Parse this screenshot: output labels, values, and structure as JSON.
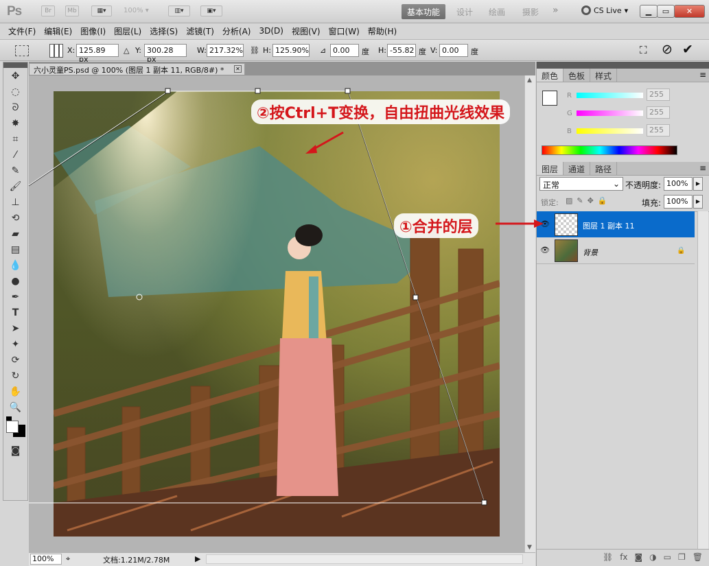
{
  "appbar": {
    "logo": "Ps",
    "bridge": "Br",
    "minibridge": "Mb",
    "zoom": "100%",
    "workspaces": [
      "基本功能",
      "设计",
      "绘画",
      "摄影"
    ],
    "more": "»",
    "cslive": "CS Live"
  },
  "menubar": [
    "文件(F)",
    "编辑(E)",
    "图像(I)",
    "图层(L)",
    "选择(S)",
    "滤镜(T)",
    "分析(A)",
    "3D(D)",
    "视图(V)",
    "窗口(W)",
    "帮助(H)"
  ],
  "options": {
    "x_label": "X:",
    "x_value": "125.89 px",
    "y_label": "Y:",
    "y_value": "300.28 px",
    "w_label": "W:",
    "w_value": "217.32%",
    "h_label": "H:",
    "h_value": "125.90%",
    "angle_value": "0.00",
    "deg": "度",
    "hskew_label": "H:",
    "hskew_value": "-55.82",
    "vskew_label": "V:",
    "vskew_value": "0.00"
  },
  "document": {
    "tab_title": "六小灵童PS.psd @ 100% (图层 1 副本 11, RGB/8#) *",
    "zoom": "100%",
    "doc_info": "文档:1.21M/2.78M"
  },
  "annotations": {
    "transform": "②按Ctrl+T变换，自由扭曲光线效果",
    "merged": "①合并的层"
  },
  "color_panel": {
    "tabs": [
      "颜色",
      "色板",
      "样式"
    ],
    "r_label": "R",
    "r_value": "255",
    "g_label": "G",
    "g_value": "255",
    "b_label": "B",
    "b_value": "255"
  },
  "layers_panel": {
    "tabs": [
      "图层",
      "通道",
      "路径"
    ],
    "blend_mode": "正常",
    "opacity_label": "不透明度:",
    "opacity": "100%",
    "lock_label": "锁定:",
    "fill_label": "填充:",
    "fill": "100%",
    "layers": [
      {
        "name": "图层 1 副本 11",
        "selected": true
      },
      {
        "name": "背景",
        "selected": false
      }
    ]
  },
  "colors": {
    "selection": "#0a6bcb",
    "annotation_red": "#d4161b"
  }
}
